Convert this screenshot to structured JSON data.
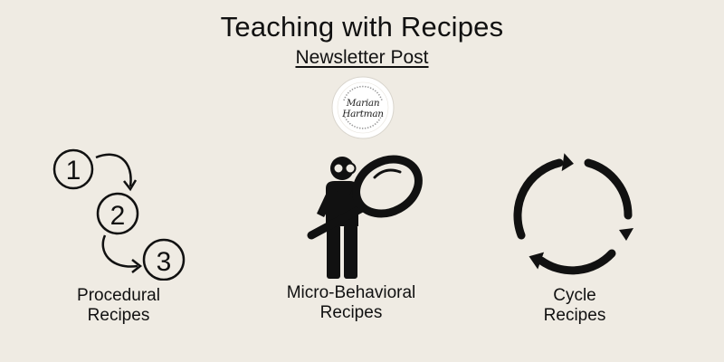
{
  "header": {
    "title": "Teaching with Recipes",
    "subtitle": "Newsletter Post"
  },
  "logo": {
    "icon": "logo-badge-icon",
    "signature": "Marian Hartman"
  },
  "recipes": [
    {
      "icon": "numbered-steps-icon",
      "line1": "Procedural",
      "line2": "Recipes",
      "steps": [
        "1",
        "2",
        "3"
      ]
    },
    {
      "icon": "magnifying-glass-person-icon",
      "line1": "Micro-Behavioral",
      "line2": "Recipes"
    },
    {
      "icon": "cycle-arrows-icon",
      "line1": "Cycle",
      "line2": "Recipes"
    }
  ],
  "colors": {
    "background": "#efebe3",
    "ink": "#111111",
    "logo_bg": "#ffffff"
  }
}
